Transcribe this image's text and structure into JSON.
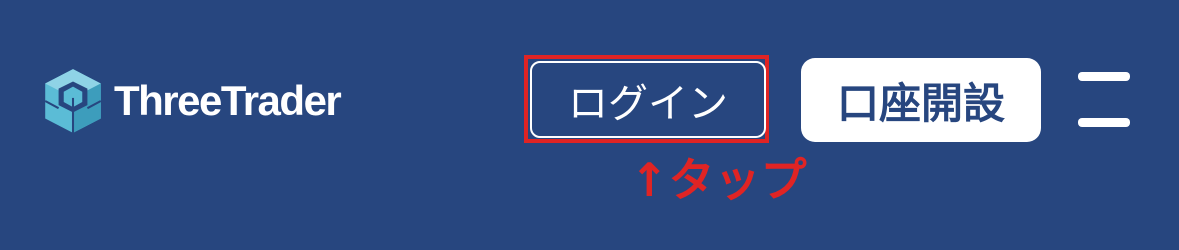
{
  "header": {
    "logo": {
      "icon": "threetrader-logo-icon",
      "text": "ThreeTrader"
    },
    "login_label": "ログイン",
    "signup_label": "口座開設",
    "menu_icon": "hamburger-menu-icon"
  },
  "annotation": {
    "text": "↑タップ",
    "color": "#e02424"
  },
  "colors": {
    "background": "#27467f",
    "logo_mark": "#5bbcd6",
    "signup_text": "#27467f"
  }
}
